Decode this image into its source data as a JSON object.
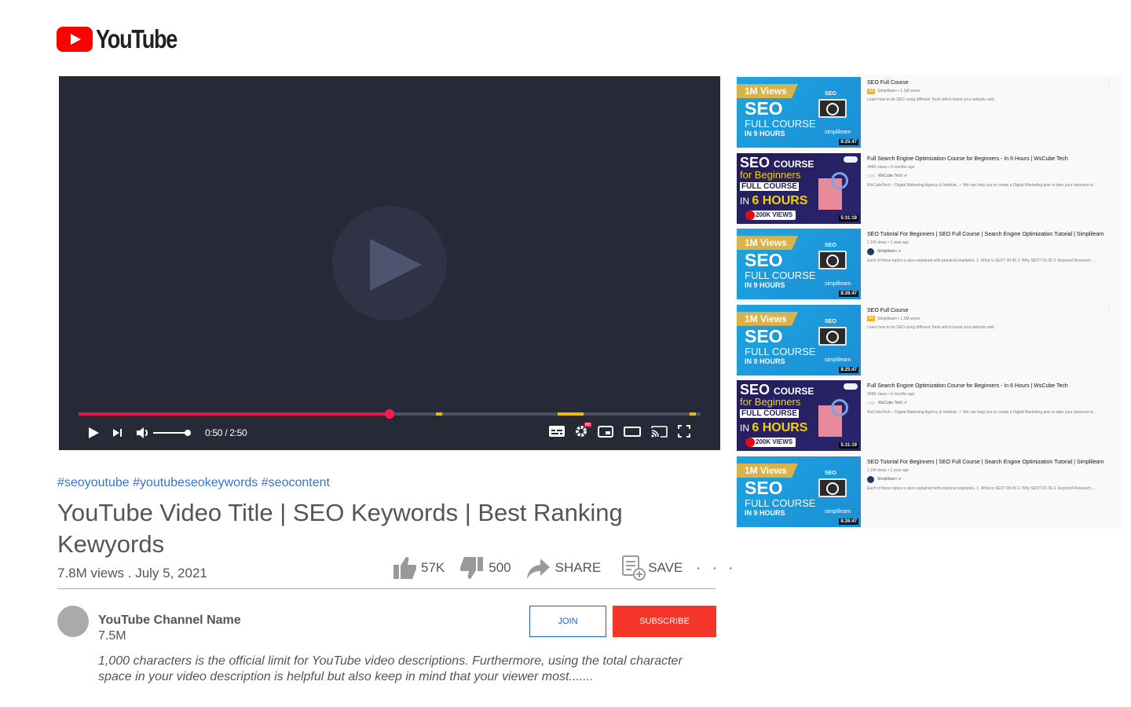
{
  "header": {
    "logo_text": "YouTube",
    "logo_icon": "youtube-play-logo-icon",
    "brand_color": "#ff0000"
  },
  "player": {
    "current_time": "0:50",
    "duration": "2:50",
    "time_display": "0:50 / 2:50",
    "played_fraction": 0.5,
    "volume_fraction": 1.0,
    "chapter_markers_fraction": [
      [
        0.575,
        0.585
      ],
      [
        0.77,
        0.812
      ],
      [
        0.982,
        0.992
      ]
    ],
    "colors": {
      "background": "#262a37",
      "progress": "#e6174a",
      "marker": "#f5b800"
    },
    "controls": {
      "play": "play-icon",
      "next": "next-icon",
      "volume": "volume-icon",
      "captions": "captions-icon",
      "settings": "settings-icon",
      "settings_badge": "HD",
      "miniplayer": "miniplayer-icon",
      "theater": "theater-mode-icon",
      "cast": "cast-icon",
      "fullscreen": "fullscreen-icon"
    }
  },
  "video": {
    "hashtags": [
      "#seoyoutube",
      "#youtubeseokeywords",
      "#seocontent"
    ],
    "title": "YouTube Video Title | SEO Keywords | Best Ranking Kewyords",
    "views_date": "7.8M views . July 5, 2021",
    "actions": {
      "likes": "57K",
      "dislikes": "500",
      "share": "SHARE",
      "save": "SAVE",
      "more": "· · ·"
    }
  },
  "channel": {
    "name": "YouTube Channel Name",
    "subscribers": "7.5M",
    "join_label": "JOIN",
    "subscribe_label": "SUBSCRIBE",
    "description": "1,000 characters is the official limit for YouTube video descriptions. Furthermore, using the total character space in your video description is helpful but also keep in mind that your viewer most......."
  },
  "recommendations": [
    {
      "type": "ad",
      "title": "SEO Full Course",
      "ad_label": "Ad",
      "sub": "Simplilearn • 1.1M views",
      "description": "Learn how to do SEO using different Tools which boost your website rank",
      "thumb": {
        "style": "simpli",
        "ribbon": "1M Views",
        "big": "SEO",
        "line1": "FULL COURSE",
        "line2": "IN 9 HOURS",
        "brand": "simplilearn",
        "mini": "SEO",
        "duration": "8:25:47"
      }
    },
    {
      "type": "video",
      "title": "Full Search Engine Optimization Course for Beginners - In 6 Hours | WsCube Tech",
      "sub": "349K views • 5 months ago",
      "channel": "WsCube Tech",
      "description": "WsCubeTech – Digital Marketing Agency & Institute. ✓ We can help you to create a Digital Marketing plan to take your business to ...",
      "thumb": {
        "style": "wscube",
        "big": "SEO",
        "big_small": "COURSE",
        "line1": "for Beginners",
        "line2": "FULL COURSE",
        "line3": "IN",
        "line3b": "6 HOURS",
        "views": "200K VIEWS",
        "duration": "5:31:19"
      }
    },
    {
      "type": "video",
      "title": "SEO Tutorial For Beginners | SEO Full Course | Search Engine Optimization Tutorial | Simplilearn",
      "sub": "1.1M views • 1 year ago",
      "channel": "Simplilearn",
      "description": "Each of these topics is also explained with practical examples. 1. What is SEO? 00:45 2. Why SEO? 01:36 3. Keyword Research ...",
      "thumb": {
        "style": "simpli",
        "ribbon": "1M Views",
        "big": "SEO",
        "line1": "FULL COURSE",
        "line2": "IN 9 HOURS",
        "brand": "simplilearn",
        "mini": "SEO",
        "duration": "8:26:47"
      }
    },
    {
      "type": "ad",
      "title": "SEO Full Course",
      "ad_label": "Ad",
      "sub": "Simplilearn • 1.1M views",
      "description": "Learn how to do SEO using different Tools which boost your website rank",
      "thumb": {
        "style": "simpli",
        "ribbon": "1M Views",
        "big": "SEO",
        "line1": "FULL COURSE",
        "line2": "IN 9 HOURS",
        "brand": "simplilearn",
        "mini": "SEO",
        "duration": "8:25:47"
      }
    },
    {
      "type": "video",
      "title": "Full Search Engine Optimization Course for Beginners - In 6 Hours | WsCube Tech",
      "sub": "349K views • 5 months ago",
      "channel": "WsCube Tech",
      "description": "WsCubeTech – Digital Marketing Agency & Institute. ✓ We can help you to create a Digital Marketing plan to take your business to ...",
      "thumb": {
        "style": "wscube",
        "big": "SEO",
        "big_small": "COURSE",
        "line1": "for Beginners",
        "line2": "FULL COURSE",
        "line3": "IN",
        "line3b": "6 HOURS",
        "views": "200K VIEWS",
        "duration": "5:31:19"
      }
    },
    {
      "type": "video",
      "title": "SEO Tutorial For Beginners | SEO Full Course | Search Engine Optimization Tutorial | Simplilearn",
      "sub": "1.1M views • 1 year ago",
      "channel": "Simplilearn",
      "description": "Each of these topics is also explained with practical examples. 1. What is SEO? 00:45 2. Why SEO? 01:36 3. Keyword Research ...",
      "thumb": {
        "style": "simpli",
        "ribbon": "1M Views",
        "big": "SEO",
        "line1": "FULL COURSE",
        "line2": "IN 9 HOURS",
        "brand": "simplilearn",
        "mini": "SEO",
        "duration": "8:26:47"
      }
    }
  ]
}
